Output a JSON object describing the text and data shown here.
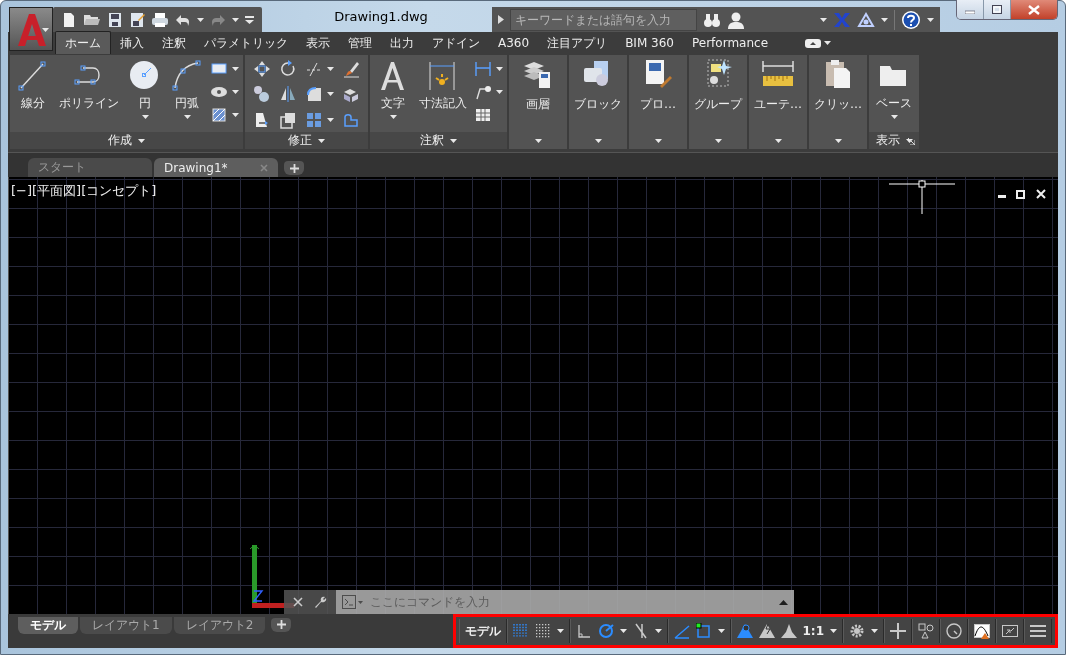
{
  "window": {
    "title": "Drawing1.dwg"
  },
  "search": {
    "placeholder": "キーワードまたは語句を入力"
  },
  "ribbon": {
    "tabs": [
      {
        "label": "ホーム",
        "selected": true
      },
      {
        "label": "挿入",
        "selected": false
      },
      {
        "label": "注釈",
        "selected": false
      },
      {
        "label": "パラメトリック",
        "selected": false
      },
      {
        "label": "表示",
        "selected": false
      },
      {
        "label": "管理",
        "selected": false
      },
      {
        "label": "出力",
        "selected": false
      },
      {
        "label": "アドイン",
        "selected": false
      },
      {
        "label": "A360",
        "selected": false
      },
      {
        "label": "注目アプリ",
        "selected": false
      },
      {
        "label": "BIM 360",
        "selected": false
      },
      {
        "label": "Performance",
        "selected": false
      }
    ],
    "panels": [
      {
        "kind": "full",
        "title": "作成",
        "title_dropdown": true,
        "tools": [
          {
            "kind": "line",
            "label": "線分",
            "dropdown": false
          },
          {
            "kind": "polyline",
            "label": "ポリライン",
            "dropdown": false
          },
          {
            "kind": "circle",
            "label": "円",
            "dropdown": true
          },
          {
            "kind": "arc",
            "label": "円弧",
            "dropdown": true
          }
        ],
        "small_tools": [
          {
            "kind": "rectangle",
            "dropdown": true
          },
          {
            "kind": "hatch-eye",
            "dropdown": true
          },
          {
            "kind": "hatch",
            "dropdown": true
          }
        ]
      },
      {
        "kind": "full",
        "title": "修正",
        "title_dropdown": true,
        "small_tools": [
          {
            "kind": "move",
            "dropdown": false
          },
          {
            "kind": "rotate",
            "dropdown": false
          },
          {
            "kind": "trim",
            "dropdown": true
          },
          {
            "kind": "erase",
            "dropdown": false
          },
          {
            "kind": "copy",
            "dropdown": false
          },
          {
            "kind": "mirror",
            "dropdown": false
          },
          {
            "kind": "fillet",
            "dropdown": true
          },
          {
            "kind": "explode",
            "dropdown": false
          },
          {
            "kind": "stretch",
            "dropdown": false
          },
          {
            "kind": "scale",
            "dropdown": false
          },
          {
            "kind": "array",
            "dropdown": true
          },
          {
            "kind": "offset",
            "dropdown": false
          }
        ]
      },
      {
        "kind": "full",
        "title": "注釈",
        "title_dropdown": true,
        "tools": [
          {
            "kind": "text",
            "label": "文字",
            "dropdown": true
          },
          {
            "kind": "dimension",
            "label": "寸法記入",
            "dropdown": false
          }
        ],
        "small_tools": [
          {
            "kind": "linear-dim",
            "dropdown": true
          },
          {
            "kind": "leader",
            "dropdown": true
          },
          {
            "kind": "table",
            "dropdown": false
          }
        ]
      },
      {
        "kind": "collapsed",
        "label": "画層"
      },
      {
        "kind": "collapsed",
        "label": "ブロック"
      },
      {
        "kind": "collapsed",
        "label": "プロ…"
      },
      {
        "kind": "collapsed",
        "label": "グループ"
      },
      {
        "kind": "collapsed",
        "label": "ユーテ…"
      },
      {
        "kind": "collapsed",
        "label": "クリッ…"
      },
      {
        "kind": "full",
        "title": "表示",
        "title_dropdown": true,
        "launcher": true,
        "tools": [
          {
            "kind": "folder",
            "label": "ベース",
            "dropdown": true
          }
        ]
      }
    ]
  },
  "doc_tabs": [
    {
      "label": "スタート",
      "selected": false,
      "closable": false
    },
    {
      "label": "Drawing1*",
      "selected": true,
      "closable": true
    }
  ],
  "viewport": {
    "label": "[−][平面図][コンセプト]"
  },
  "command_line": {
    "placeholder": "ここにコマンドを入力"
  },
  "layout_tabs": [
    {
      "label": "モデル",
      "selected": true
    },
    {
      "label": "レイアウト1",
      "selected": false
    },
    {
      "label": "レイアウト2",
      "selected": false
    }
  ],
  "status_bar": {
    "highlighted": true,
    "groups": [
      {
        "items": [
          {
            "kind": "label",
            "label": "モデル",
            "dropdown": false
          }
        ]
      },
      {
        "items": [
          {
            "kind": "grid",
            "on": true,
            "dropdown": false
          },
          {
            "kind": "snap",
            "on": false,
            "dropdown": true
          }
        ]
      },
      {
        "items": [
          {
            "kind": "ortho",
            "on": false,
            "dropdown": false
          },
          {
            "kind": "polar",
            "on": true,
            "dropdown": true
          },
          {
            "kind": "isodraft",
            "on": false,
            "dropdown": true
          }
        ]
      },
      {
        "items": [
          {
            "kind": "otrack",
            "on": true,
            "dropdown": false
          },
          {
            "kind": "osnap",
            "on": true,
            "dropdown": true
          }
        ]
      },
      {
        "items": [
          {
            "kind": "annovis",
            "on": true,
            "dropdown": false
          },
          {
            "kind": "autoscale",
            "on": false,
            "dropdown": false
          },
          {
            "kind": "annoscale",
            "on": false,
            "dropdown": false
          },
          {
            "kind": "label",
            "label": "1:1",
            "dropdown": true
          }
        ]
      },
      {
        "items": [
          {
            "kind": "gear",
            "on": false,
            "dropdown": true
          }
        ]
      },
      {
        "items": [
          {
            "kind": "plus",
            "on": false,
            "dropdown": false
          }
        ]
      },
      {
        "items": [
          {
            "kind": "isolate",
            "on": false,
            "dropdown": false
          }
        ]
      },
      {
        "items": [
          {
            "kind": "hardware",
            "on": false,
            "dropdown": false
          }
        ]
      },
      {
        "items": [
          {
            "kind": "performance",
            "on": false,
            "dropdown": false
          }
        ]
      },
      {
        "items": [
          {
            "kind": "fullscreen",
            "on": false,
            "dropdown": false
          }
        ]
      },
      {
        "items": [
          {
            "kind": "menu",
            "on": false,
            "dropdown": false
          }
        ]
      }
    ]
  }
}
